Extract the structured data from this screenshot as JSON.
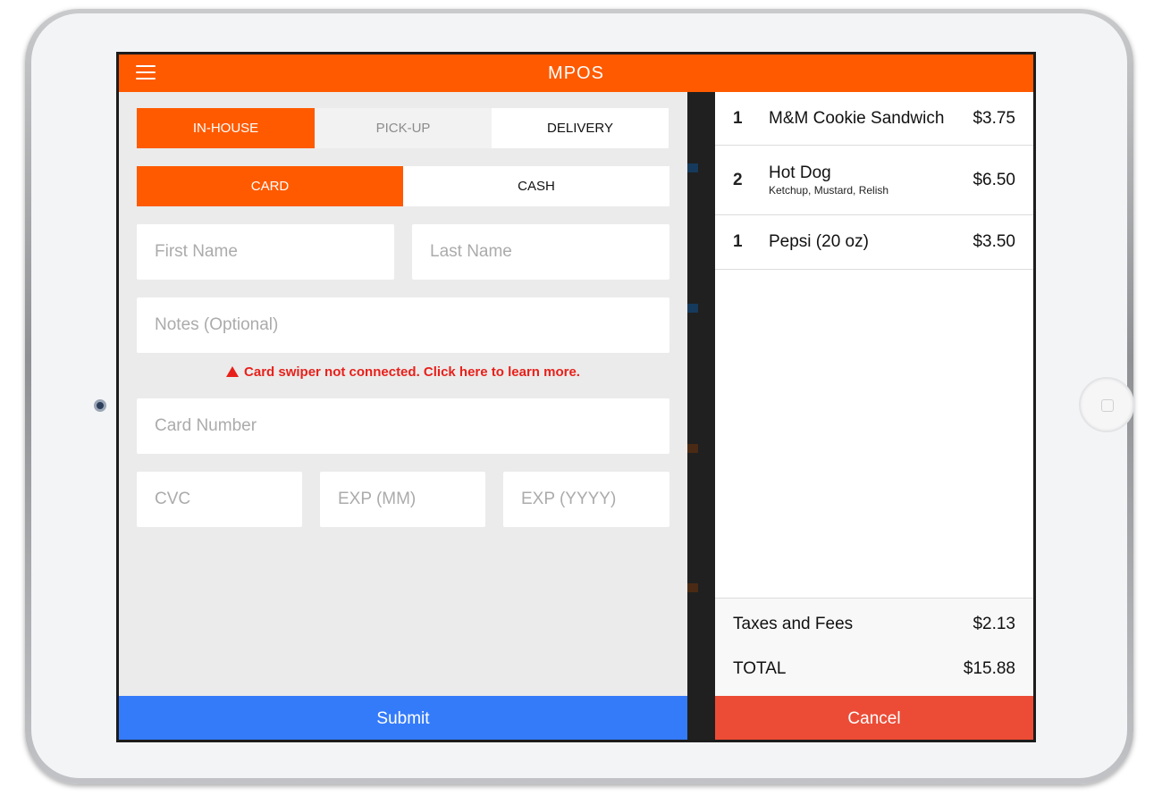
{
  "app": {
    "title": "MPOS",
    "menu_icon": "hamburger-menu-icon"
  },
  "order_type": {
    "options": [
      {
        "label": "IN-HOUSE",
        "state": "active"
      },
      {
        "label": "PICK-UP",
        "state": "muted"
      },
      {
        "label": "DELIVERY",
        "state": "plain"
      }
    ]
  },
  "payment_method": {
    "options": [
      {
        "label": "CARD",
        "state": "active"
      },
      {
        "label": "CASH",
        "state": "plain"
      }
    ]
  },
  "form": {
    "first_name": {
      "placeholder": "First Name",
      "value": ""
    },
    "last_name": {
      "placeholder": "Last Name",
      "value": ""
    },
    "notes": {
      "placeholder": "Notes (Optional)",
      "value": ""
    },
    "warning": "Card swiper not connected. Click here to learn more.",
    "card_number": {
      "placeholder": "Card Number",
      "value": ""
    },
    "cvc": {
      "placeholder": "CVC",
      "value": ""
    },
    "exp_month": {
      "placeholder": "EXP (MM)",
      "value": ""
    },
    "exp_year": {
      "placeholder": "EXP (YYYY)",
      "value": ""
    },
    "submit_label": "Submit"
  },
  "order": {
    "items": [
      {
        "qty": "1",
        "name": "M&M Cookie Sandwich",
        "modifiers": "",
        "price": "$3.75"
      },
      {
        "qty": "2",
        "name": "Hot Dog",
        "modifiers": "Ketchup, Mustard, Relish",
        "price": "$6.50"
      },
      {
        "qty": "1",
        "name": "Pepsi (20 oz)",
        "modifiers": "",
        "price": "$3.50"
      }
    ],
    "taxes_label": "Taxes and Fees",
    "taxes_value": "$2.13",
    "total_label": "TOTAL",
    "total_value": "$15.88",
    "cancel_label": "Cancel"
  },
  "colors": {
    "brand": "#ff5a00",
    "submit": "#347bfa",
    "cancel": "#ec4c36",
    "warning": "#e8201a"
  }
}
